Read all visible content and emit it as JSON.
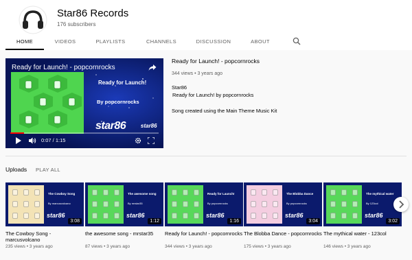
{
  "channel": {
    "name": "Star86 Records",
    "subscribers": "176 subscribers"
  },
  "tabs": [
    {
      "label": "HOME",
      "active": true
    },
    {
      "label": "VIDEOS"
    },
    {
      "label": "PLAYLISTS"
    },
    {
      "label": "CHANNELS"
    },
    {
      "label": "DISCUSSION"
    },
    {
      "label": "ABOUT"
    }
  ],
  "featured": {
    "player_title": "Ready for Launch! - popcornrocks",
    "thumb_line1": "Ready for Launch!",
    "thumb_line2": "By popcornrocks",
    "logo": "star86",
    "time": "0:07 / 1:15",
    "progress": 0.093,
    "title": "Ready for Launch! - popcornrocks",
    "meta": "344 views • 3 years ago",
    "desc_line1": "Star86",
    "desc_line2": "Ready for Launch! by popcornrocks",
    "desc_line3": "Song created using the Main Theme Music Kit"
  },
  "uploads": {
    "title": "Uploads",
    "play_all": "PLAY ALL",
    "videos": [
      {
        "title": "The Cowboy Song - marcusvolcano",
        "meta": "235 views • 3 years ago",
        "duration": "3:08",
        "thumb_title": "The Cowboy Song",
        "thumb_author": "By marcusvolcano",
        "pattern": "#f3e3b6"
      },
      {
        "title": "the awesome song - mrstar35",
        "meta": "87 views • 3 years ago",
        "duration": "1:12",
        "thumb_title": "The awesome song",
        "thumb_author": "By mrstar35",
        "pattern": "#58d85a"
      },
      {
        "title": "Ready for Launch! - popcornrocks",
        "meta": "344 views • 3 years ago",
        "duration": "1:16",
        "thumb_title": "Ready for Launch!",
        "thumb_author": "By popcornrocks",
        "pattern": "#58d85a"
      },
      {
        "title": "The Blobba Dance - popcornrocks",
        "meta": "175 views • 3 years ago",
        "duration": "3:04",
        "thumb_title": "The Blobba Dance",
        "thumb_author": "By popcornrocks",
        "pattern": "#f4cde0"
      },
      {
        "title": "The mythical water - 123col",
        "meta": "146 views • 3 years ago",
        "duration": "3:02",
        "thumb_title": "The mythical water",
        "thumb_author": "By 123col",
        "pattern": "#58d85a"
      }
    ]
  },
  "colors": {
    "thumb_bg": "#0b1a6c",
    "accent": "#ff0000"
  }
}
